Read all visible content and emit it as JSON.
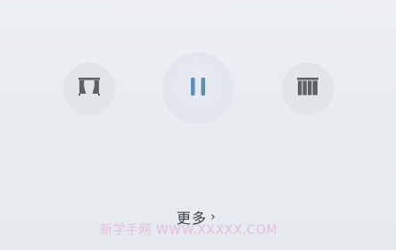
{
  "controls": {
    "open_icon": "curtain-open-icon",
    "pause_icon": "pause-icon",
    "close_icon": "curtain-closed-icon",
    "accent_color": "#5b8fb9"
  },
  "footer": {
    "more_label": "更多",
    "more_chevron": "›"
  },
  "watermark": {
    "text": "新学手网 WWW.XXXXX.COM"
  }
}
